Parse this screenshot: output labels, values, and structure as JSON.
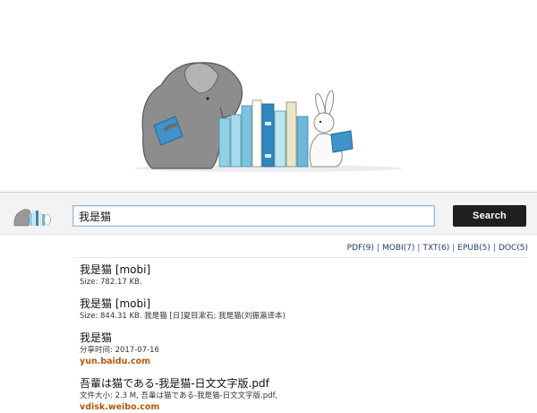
{
  "search": {
    "query": "我是猫",
    "button_label": "Search"
  },
  "filters": [
    {
      "label": "PDF(9)"
    },
    {
      "label": "MOBI(7)"
    },
    {
      "label": "TXT(6)"
    },
    {
      "label": "EPUB(5)"
    },
    {
      "label": "DOC(5)"
    }
  ],
  "results": [
    {
      "title": "我是猫 [mobi]",
      "meta": "Size: 782.17 KB.",
      "source": ""
    },
    {
      "title": "我是猫 [mobi]",
      "meta": "Size: 844.31 KB. 我是猫 [日]夏目漱石; 我是猫(刘振瀛译本)",
      "source": ""
    },
    {
      "title": "我是猫",
      "meta": "分享时间: 2017-07-16",
      "source": "yun.baidu.com"
    },
    {
      "title": "吾輩は猫である-我是猫-日文文字版.pdf",
      "meta": "文件大小: 2.3 M, 吾輩は猫である-我是猫-日文文字版.pdf,",
      "source": "vdisk.weibo.com"
    }
  ],
  "colors": {
    "filter_link": "#1a3c7a",
    "source_link": "#b35a12",
    "button_bg": "#1f1f1f"
  },
  "icons": {
    "hero": "elephant-and-rabbit-reading-with-books",
    "mini_logo": "elephant-bookends-logo"
  }
}
